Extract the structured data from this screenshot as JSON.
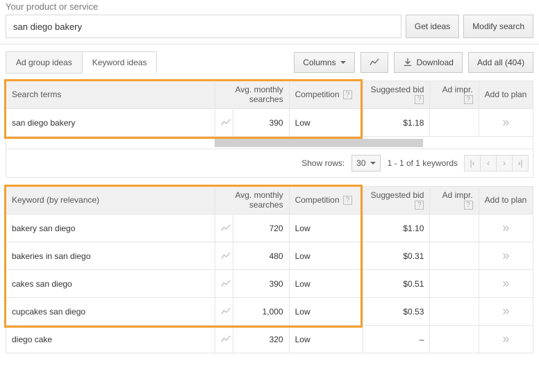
{
  "header": {
    "field_label": "Your product or service",
    "search_value": "san diego bakery",
    "get_ideas": "Get ideas",
    "modify_search": "Modify search"
  },
  "tabs": {
    "adgroup": "Ad group ideas",
    "keyword": "Keyword ideas"
  },
  "toolbar": {
    "columns": "Columns",
    "download": "Download",
    "add_all": "Add all (404)"
  },
  "columns": {
    "search_terms": "Search terms",
    "avg_monthly": "Avg. monthly searches",
    "competition": "Competition",
    "suggested_bid": "Suggested bid",
    "ad_impr": "Ad impr.",
    "add_to_plan": "Add to plan",
    "keyword_by_rel": "Keyword (by relevance)"
  },
  "search_terms_rows": [
    {
      "term": "san diego bakery",
      "searches": "390",
      "competition": "Low",
      "bid": "$1.18"
    }
  ],
  "keyword_rows": [
    {
      "term": "bakery san diego",
      "searches": "720",
      "competition": "Low",
      "bid": "$1.10"
    },
    {
      "term": "bakeries in san diego",
      "searches": "480",
      "competition": "Low",
      "bid": "$0.31"
    },
    {
      "term": "cakes san diego",
      "searches": "390",
      "competition": "Low",
      "bid": "$0.51"
    },
    {
      "term": "cupcakes san diego",
      "searches": "1,000",
      "competition": "Low",
      "bid": "$0.53"
    },
    {
      "term": "diego cake",
      "searches": "320",
      "competition": "Low",
      "bid": "–"
    }
  ],
  "pager": {
    "show_rows": "Show rows:",
    "rows_value": "30",
    "summary": "1 - 1 of 1 keywords"
  }
}
